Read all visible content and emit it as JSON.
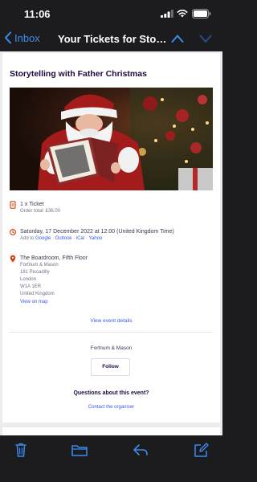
{
  "status_bar": {
    "time": "11:06"
  },
  "nav": {
    "back_label": "Inbox",
    "title": "Your Tickets for Storytelling with Father Christmas"
  },
  "colors": {
    "accent": "#3b8cf0",
    "event_red": "#d1410c",
    "link_blue": "#3659e3"
  },
  "email": {
    "event_title": "Storytelling with Father Christmas",
    "hero_image_alt": "Father Christmas reading a book",
    "ticket": {
      "label": "1 x Ticket",
      "order_total": "Order total: £36.00"
    },
    "date": {
      "text": "Saturday, 17 December 2022 at 12:00 (United Kingdom Time)",
      "add_to_label": "Add to",
      "calendars": [
        "Google",
        "Outlook",
        "iCal",
        "Yahoo"
      ],
      "separator": "·"
    },
    "location": {
      "venue": "The Boardroom, Fifth Floor",
      "address_lines": [
        "Fortnum & Mason",
        "181 Piccadilly",
        "London",
        "W1A 1ER",
        "United Kingdom"
      ],
      "map_link": "View on map"
    },
    "view_event_details": "View event details",
    "organizer": {
      "name": "Fortnum & Mason",
      "follow_label": "Follow"
    },
    "questions": {
      "heading": "Questions about this event?",
      "contact_link": "Contact the organiser"
    }
  },
  "toolbar": {
    "icons": [
      "trash-icon",
      "folder-icon",
      "reply-icon",
      "compose-icon"
    ]
  }
}
